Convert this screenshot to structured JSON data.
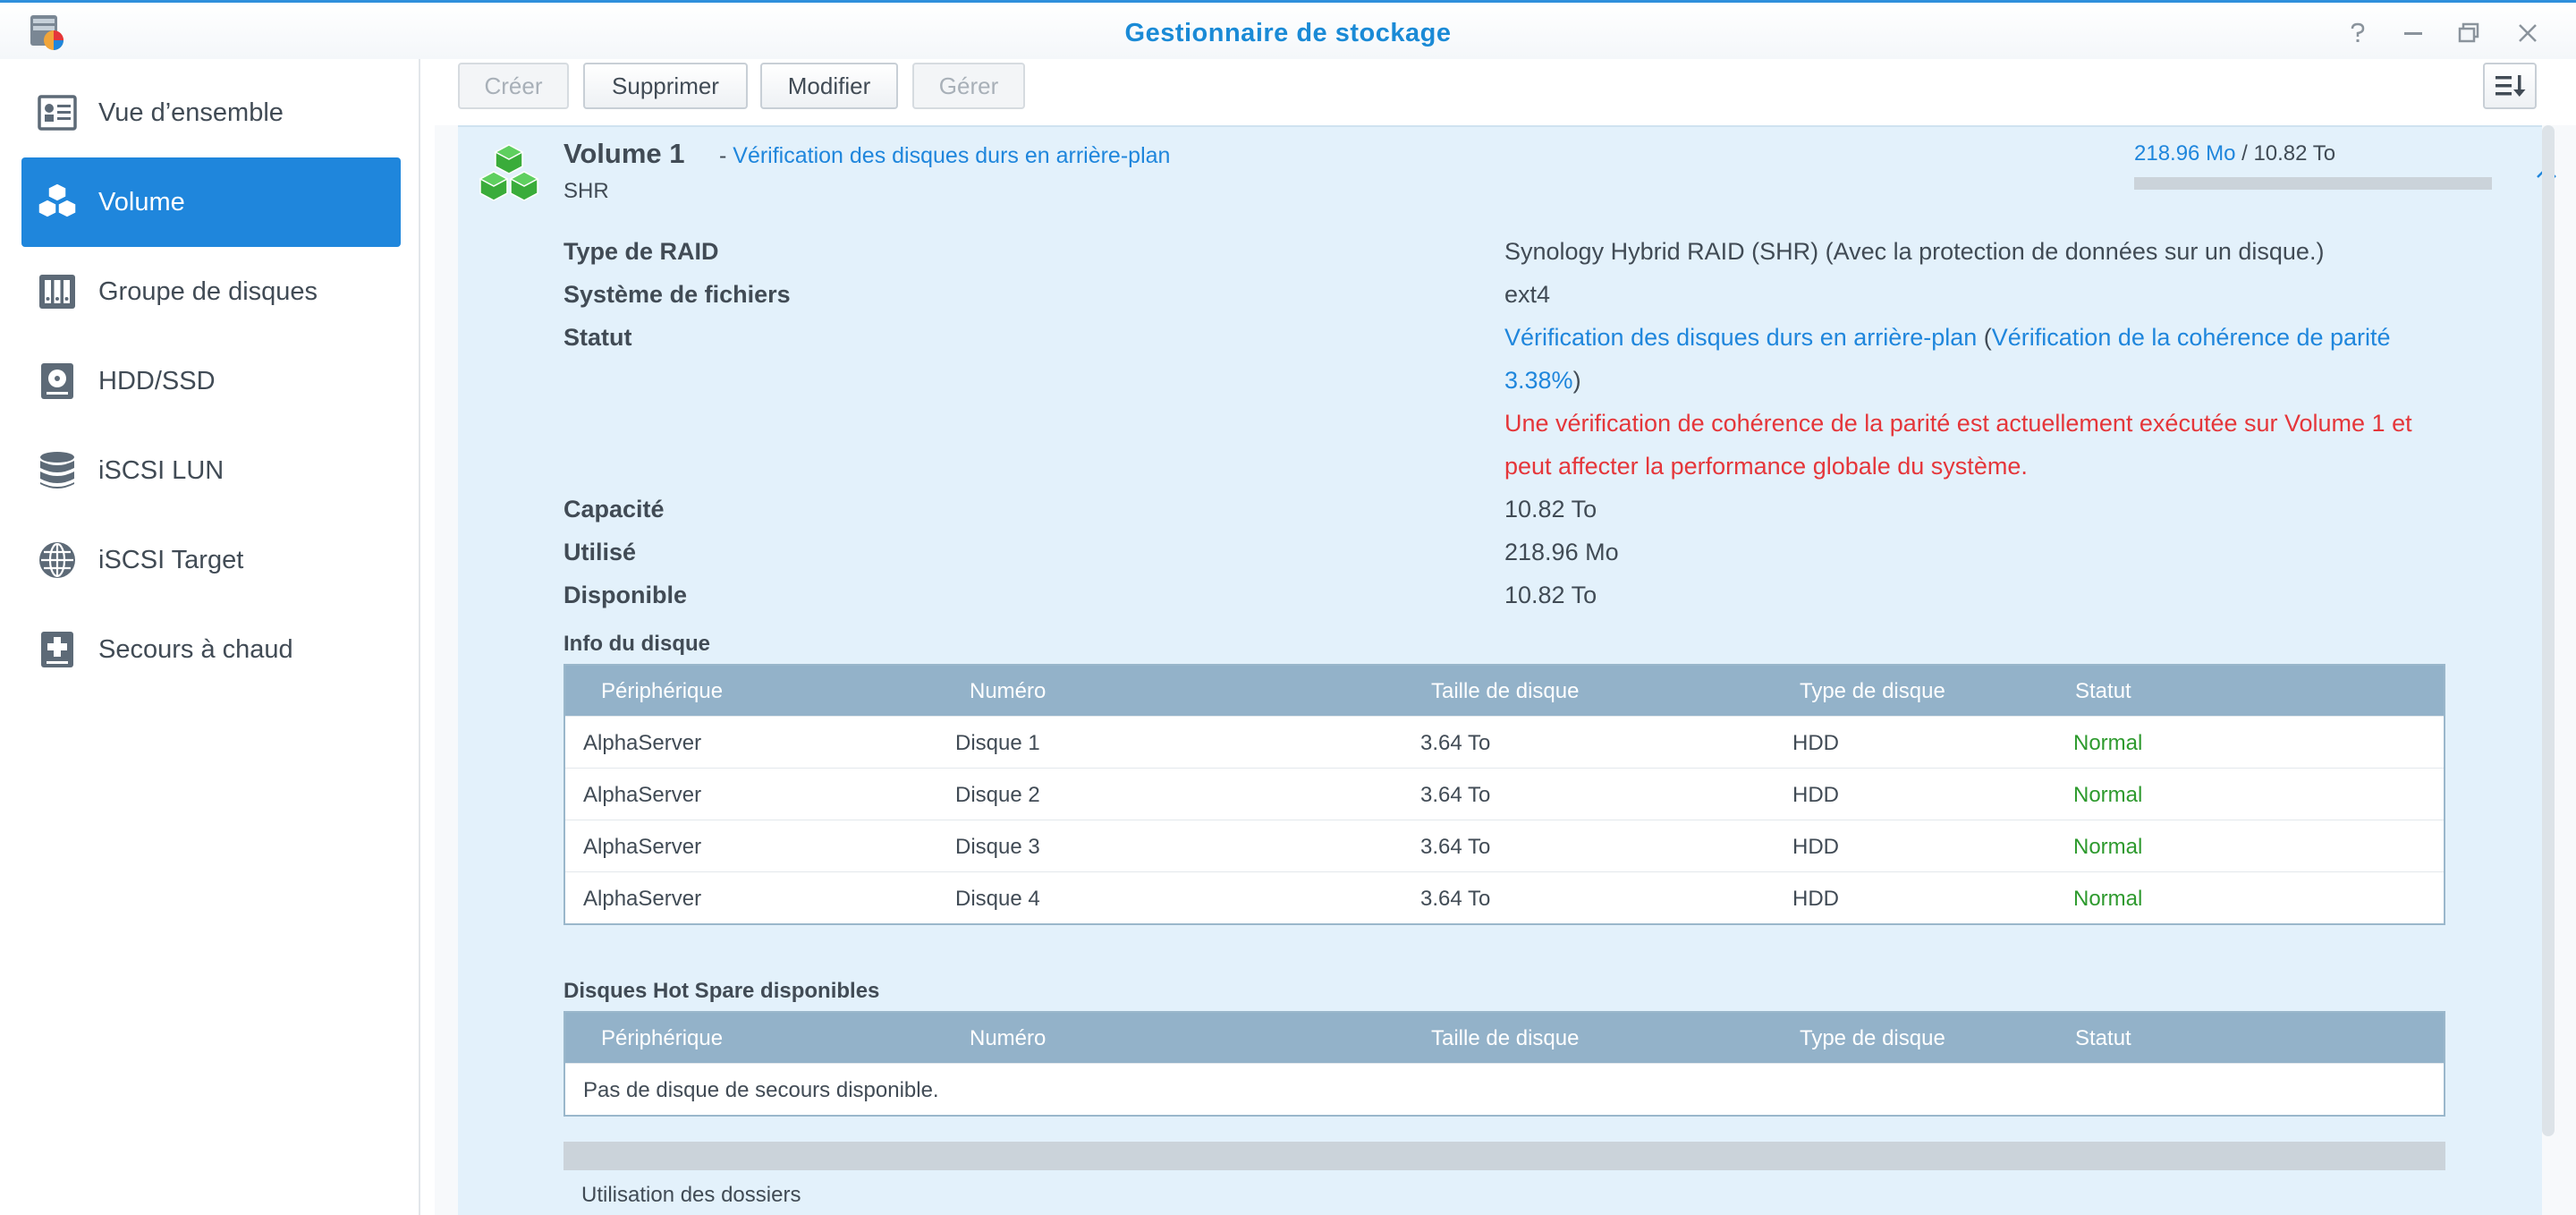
{
  "window": {
    "title": "Gestionnaire de stockage",
    "controls": [
      "help-icon",
      "minimize-icon",
      "maximize-icon",
      "close-icon"
    ],
    "accent_color": "#1f86dc"
  },
  "sidebar": {
    "items": [
      {
        "label": "Vue d’ensemble",
        "icon": "overview-icon",
        "active": false
      },
      {
        "label": "Volume",
        "icon": "volume-icon",
        "active": true
      },
      {
        "label": "Groupe de disques",
        "icon": "disk-group-icon",
        "active": false
      },
      {
        "label": "HDD/SSD",
        "icon": "hdd-icon",
        "active": false
      },
      {
        "label": "iSCSI LUN",
        "icon": "database-icon",
        "active": false
      },
      {
        "label": "iSCSI Target",
        "icon": "globe-icon",
        "active": false
      },
      {
        "label": "Secours à chaud",
        "icon": "hot-spare-icon",
        "active": false
      }
    ]
  },
  "toolbar": {
    "create_label": "Créer",
    "delete_label": "Supprimer",
    "edit_label": "Modifier",
    "manage_label": "Gérer"
  },
  "volume": {
    "name": "Volume 1",
    "separator": "-",
    "status_link": "Vérification des disques durs en arrière-plan",
    "raid_tag": "SHR",
    "usage_used": "218.96 Mo",
    "usage_sep": " / ",
    "usage_total": "10.82 To",
    "usage_fraction": 2e-05,
    "props": {
      "raid_label": "Type de RAID",
      "raid_value": "Synology Hybrid RAID (SHR) (Avec la protection de données sur un disque.)",
      "fs_label": "Système de fichiers",
      "fs_value": "ext4",
      "status_label": "Statut",
      "status_value": "Vérification des disques durs en arrière-plan",
      "status_paren_open": " (",
      "status_detail_1": "Vérification de la cohérence de parité",
      "status_detail_2": "3.38%",
      "status_paren_close": ")",
      "warning_line1": "Une vérification de cohérence de la parité est actuellement exécutée sur Volume 1 et",
      "warning_line2": "peut affecter la performance globale du système.",
      "capacity_label": "Capacité",
      "capacity_value": "10.82 To",
      "used_label": "Utilisé",
      "used_value": "218.96 Mo",
      "available_label": "Disponible",
      "available_value": "10.82 To"
    }
  },
  "disk_info": {
    "title": "Info du disque",
    "columns": [
      "Périphérique",
      "Numéro",
      "Taille de disque",
      "Type de disque",
      "Statut"
    ],
    "rows": [
      [
        "AlphaServer",
        "Disque 1",
        "3.64 To",
        "HDD",
        "Normal"
      ],
      [
        "AlphaServer",
        "Disque 2",
        "3.64 To",
        "HDD",
        "Normal"
      ],
      [
        "AlphaServer",
        "Disque 3",
        "3.64 To",
        "HDD",
        "Normal"
      ],
      [
        "AlphaServer",
        "Disque 4",
        "3.64 To",
        "HDD",
        "Normal"
      ]
    ],
    "status_color": "#2e9a2e"
  },
  "hot_spare": {
    "title": "Disques Hot Spare disponibles",
    "columns": [
      "Périphérique",
      "Numéro",
      "Taille de disque",
      "Type de disque",
      "Statut"
    ],
    "empty_text": "Pas de disque de secours disponible."
  },
  "folders": {
    "label": "Utilisation des dossiers"
  }
}
